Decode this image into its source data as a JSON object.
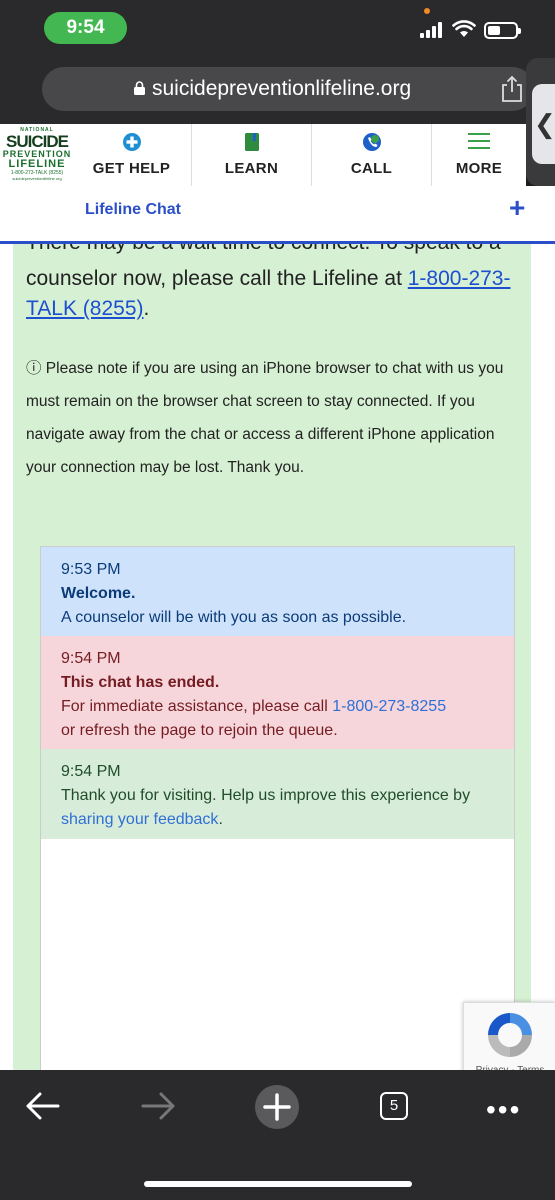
{
  "status": {
    "time": "9:54"
  },
  "browser": {
    "url": "suicidepreventionlifeline.org",
    "tab_count": "5"
  },
  "logo": {
    "line1": "NATIONAL",
    "line2": "SUICIDE",
    "line3": "PREVENTION",
    "line4": "LIFELINE",
    "line5": "1-800-273-TALK (8255)",
    "line6": "suicidepreventionlifeline.org"
  },
  "nav": {
    "items": [
      {
        "label": "GET HELP"
      },
      {
        "label": "LEARN"
      },
      {
        "label": "CALL"
      },
      {
        "label": "MORE"
      }
    ]
  },
  "chat_header": {
    "title": "Lifeline Chat",
    "plus": "+"
  },
  "content": {
    "partial_line": "There may be a wait time to connect. To speak to a",
    "lead_text": "counselor now, please call the Lifeline at ",
    "lead_phone": "1-800-273-TALK (8255)",
    "lead_end": ".",
    "note": "ⓘ Please note if you are using an iPhone browser to chat with us you must remain on the browser chat screen to stay connected. If you navigate away from the chat or access a different iPhone application your connection may be lost. Thank you."
  },
  "messages": [
    {
      "time": "9:53 PM",
      "title": "Welcome.",
      "body": "A counselor will be with you as soon as possible."
    },
    {
      "time": "9:54 PM",
      "title": "This chat has ended.",
      "body_start": "For immediate assistance, please call ",
      "phone": "1-800-273-8255",
      "body_end": "or refresh the page to rejoin the queue."
    },
    {
      "time": "9:54 PM",
      "body_start": "Thank you for visiting. Help us improve this experience by ",
      "link": "sharing your feedback",
      "body_end": "."
    }
  ],
  "recaptcha": {
    "text": "Privacy - Terms"
  },
  "colors": {
    "brand_green": "#1b6e2e",
    "chat_blue": "#2a4fc8",
    "panel_green": "#d6f0d3",
    "time_pill": "#43b852"
  }
}
